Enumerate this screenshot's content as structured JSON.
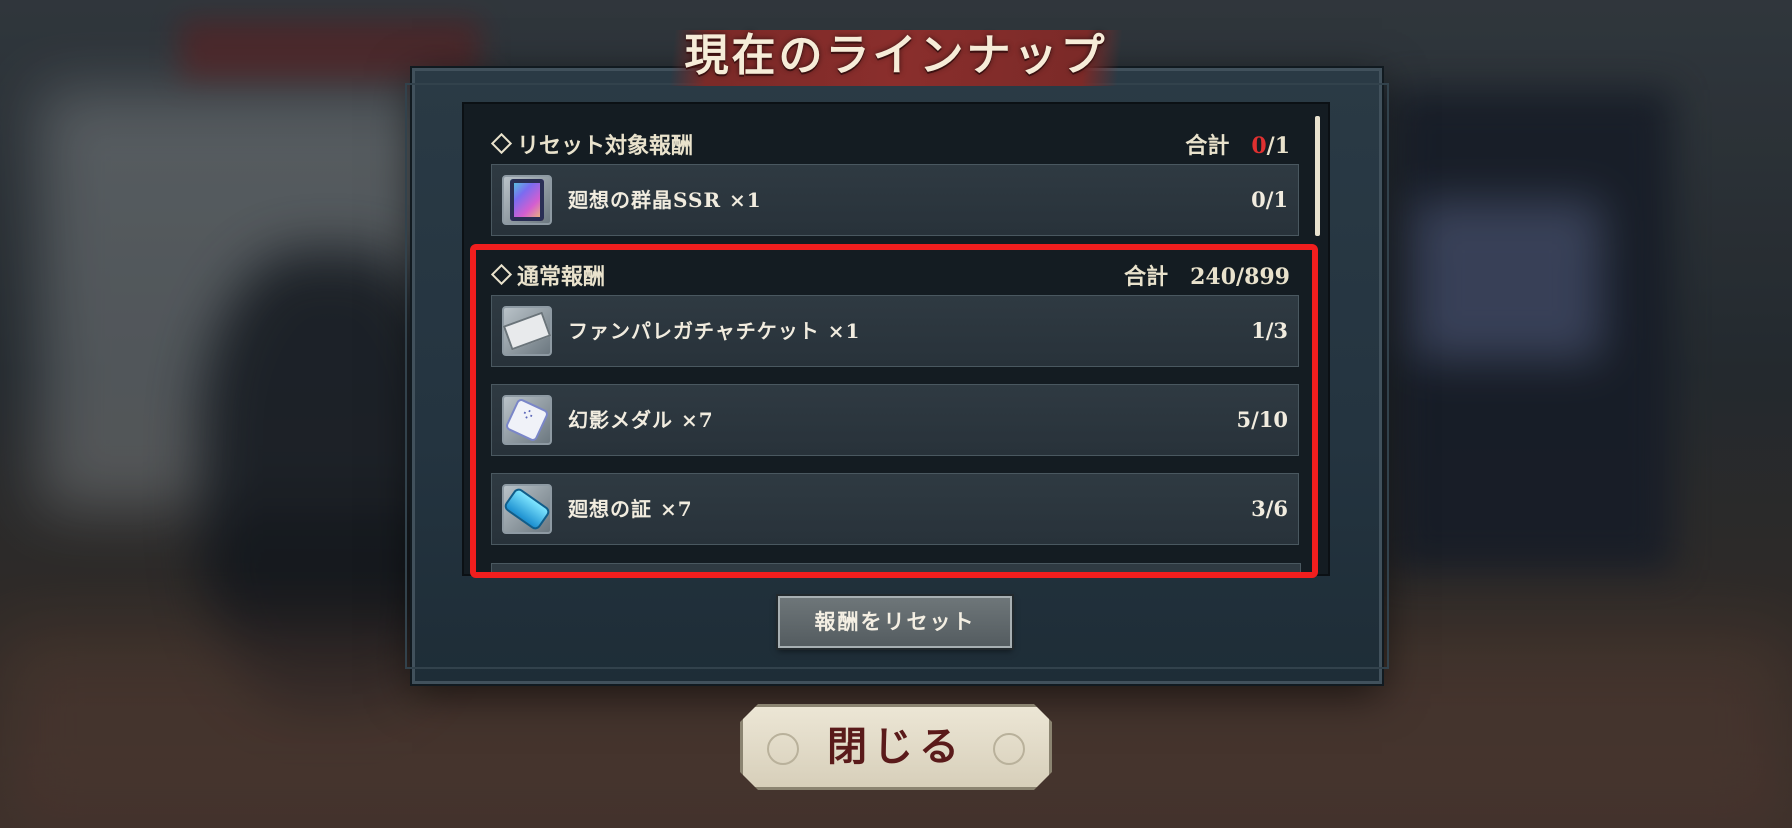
{
  "title": "現在のラインナップ",
  "reset_section": {
    "label": "リセット対象報酬",
    "total_label": "合計",
    "total_current": "0",
    "total_max": "/1",
    "items": [
      {
        "name": "廻想の群晶SSR ×1",
        "count": "0/1",
        "icon": "crystal-ssr-icon"
      }
    ]
  },
  "normal_section": {
    "label": "通常報酬",
    "total_label": "合計",
    "total_value": "240/899",
    "items": [
      {
        "name": "ファンパレガチャチケット ×1",
        "count": "1/3",
        "icon": "gacha-ticket-icon"
      },
      {
        "name": "幻影メダル ×7",
        "count": "5/10",
        "icon": "phantom-medal-icon"
      },
      {
        "name": "廻想の証 ×7",
        "count": "3/6",
        "icon": "proof-icon"
      }
    ]
  },
  "buttons": {
    "reset": "報酬をリセット",
    "close": "閉じる"
  },
  "colors": {
    "highlight": "#f11e1e",
    "accent_red": "#e03030",
    "title_plate": "#8a2e2c"
  }
}
